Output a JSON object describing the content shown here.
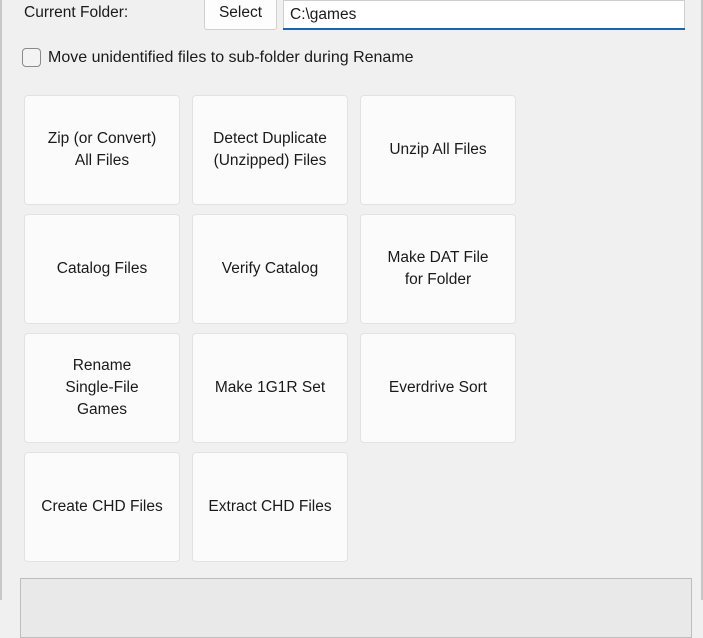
{
  "colors": {
    "background": "#f0f0f0",
    "button_face": "#fbfbfb",
    "button_border": "#e2e2e2",
    "accent_underline": "#1763b6",
    "panel_fill": "#e9e9e9",
    "panel_border": "#bdbdbd",
    "text": "#1a1a1a"
  },
  "folder": {
    "label": "Current Folder:",
    "select_button": "Select",
    "path_value": "C:\\games",
    "path_placeholder": "C:\\games"
  },
  "options": {
    "move_unidentified": {
      "label": "Move unidentified files to sub-folder during Rename",
      "checked": false
    }
  },
  "actions": {
    "rows": [
      [
        {
          "label": "Zip (or Convert)\nAll Files",
          "name": "zip-or-convert-all-files"
        },
        {
          "label": "Detect Duplicate\n(Unzipped) Files",
          "name": "detect-duplicate-unzipped-files"
        },
        {
          "label": "Unzip All Files",
          "name": "unzip-all-files"
        }
      ],
      [
        {
          "label": "Catalog Files",
          "name": "catalog-files"
        },
        {
          "label": "Verify Catalog",
          "name": "verify-catalog"
        },
        {
          "label": "Make DAT File\nfor Folder",
          "name": "make-dat-file-for-folder"
        }
      ],
      [
        {
          "label": "Rename\nSingle-File\nGames",
          "name": "rename-single-file-games"
        },
        {
          "label": "Make 1G1R Set",
          "name": "make-1g1r-set"
        },
        {
          "label": "Everdrive Sort",
          "name": "everdrive-sort"
        }
      ],
      [
        {
          "label": "Create CHD Files",
          "name": "create-chd-files"
        },
        {
          "label": "Extract CHD Files",
          "name": "extract-chd-files"
        }
      ]
    ]
  },
  "bottom_panel": {
    "content": ""
  }
}
